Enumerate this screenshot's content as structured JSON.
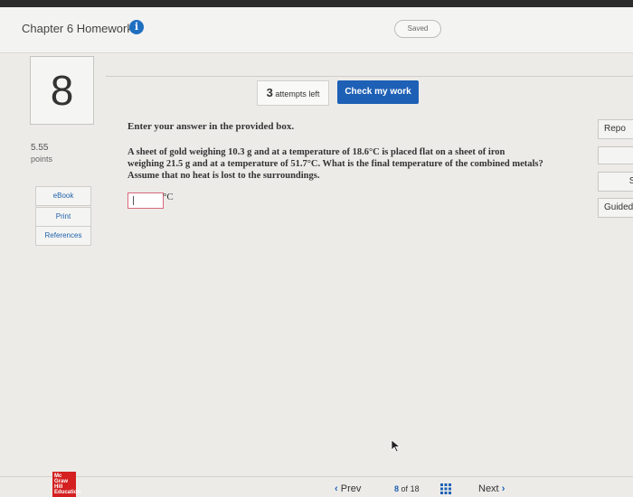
{
  "header": {
    "chapter_title": "Chapter 6 Homework",
    "info_icon": "i",
    "saved_label": "Saved"
  },
  "question": {
    "number": "8",
    "points_value": "5.55",
    "points_label": "points",
    "attempts_count": "3",
    "attempts_label": "attempts left",
    "check_button": "Check my work",
    "prompt": "Enter your answer in the provided box.",
    "text": "A sheet of gold weighing 10.3 g and at a temperature of 18.6°C is placed flat on a sheet of iron weighing 21.5 g and at a temperature of 51.7°C. What is the final temperature of the combined metals? Assume that no heat is lost to the surroundings.",
    "answer_value": "",
    "unit": "°C"
  },
  "sidebar": {
    "ebook": "eBook",
    "print": "Print",
    "references": "References"
  },
  "right_panel": {
    "report": "Repo",
    "solution": "So",
    "guided": "Guided"
  },
  "footer": {
    "logo": "Mc Graw Hill Education",
    "prev": "Prev",
    "current_page": "8",
    "of_label": "of",
    "total_pages": "18",
    "next": "Next"
  }
}
